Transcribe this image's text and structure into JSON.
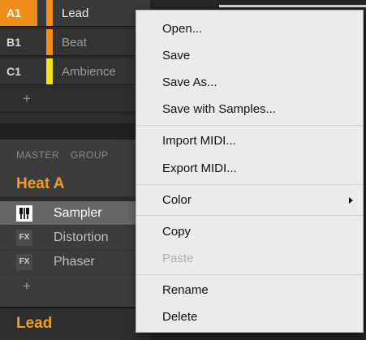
{
  "groups": [
    {
      "slot": "A1",
      "name": "Lead",
      "color": "#f08e1c",
      "selected": true
    },
    {
      "slot": "B1",
      "name": "Beat",
      "color": "#f08e1c",
      "selected": false
    },
    {
      "slot": "C1",
      "name": "Ambience",
      "color": "#f4e41a",
      "selected": false
    }
  ],
  "groups_add_label": "+",
  "panel": {
    "tabs": [
      "MASTER",
      "GROUP"
    ],
    "title": "Heat A",
    "modules": [
      {
        "icon": "sampler-icon",
        "badge": "",
        "name": "Sampler",
        "selected": true
      },
      {
        "icon": "fx-icon",
        "badge": "FX",
        "name": "Distortion",
        "selected": false
      },
      {
        "icon": "fx-icon",
        "badge": "FX",
        "name": "Phaser",
        "selected": false
      }
    ],
    "add_label": "+"
  },
  "bottom_label": "Lead",
  "menu": {
    "items": [
      {
        "label": "Open...",
        "enabled": true
      },
      {
        "label": "Save",
        "enabled": true
      },
      {
        "label": "Save As...",
        "enabled": true
      },
      {
        "label": "Save with Samples...",
        "enabled": true
      },
      {
        "label": "Import MIDI...",
        "enabled": true
      },
      {
        "label": "Export MIDI...",
        "enabled": true
      },
      {
        "label": "Color",
        "enabled": true,
        "submenu": true
      },
      {
        "label": "Copy",
        "enabled": true
      },
      {
        "label": "Paste",
        "enabled": false
      },
      {
        "label": "Rename",
        "enabled": true
      },
      {
        "label": "Delete",
        "enabled": true
      }
    ]
  },
  "accent_color": "#f39a2c"
}
